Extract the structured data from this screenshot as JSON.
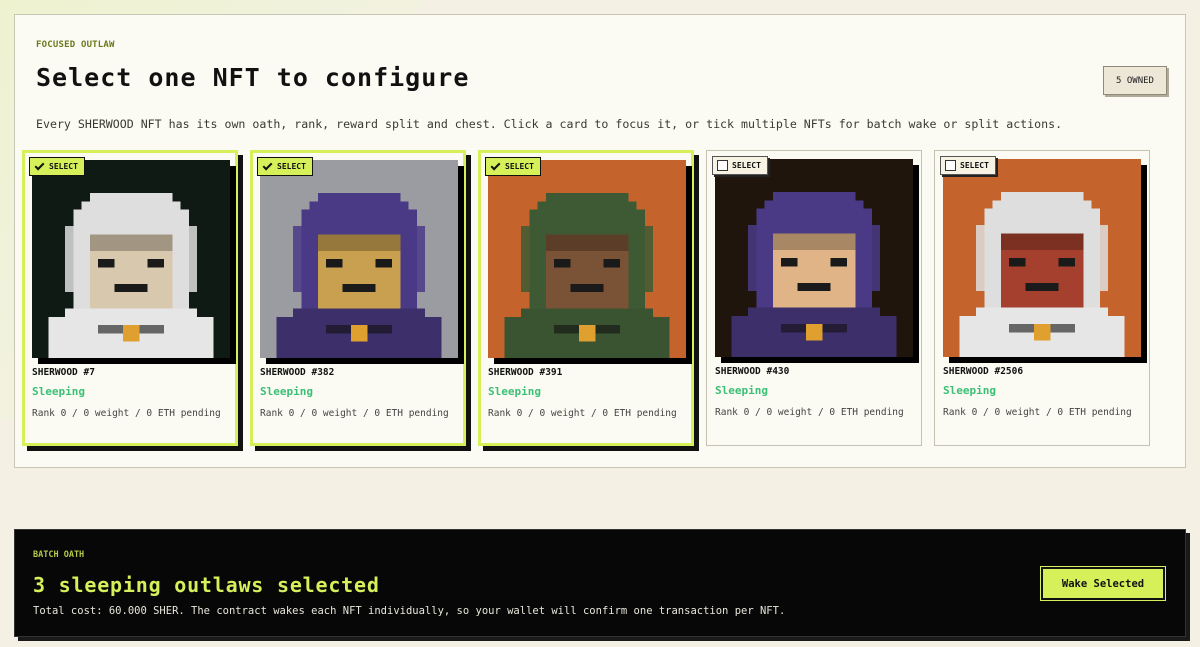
{
  "header": {
    "kicker": "FOCUSED OUTLAW",
    "title": "Select one NFT to configure",
    "owned_badge": "5 OWNED",
    "description": "Every SHERWOOD NFT has its own oath, rank, reward split and chest. Click a card to focus it, or tick multiple NFTs for batch wake or split actions."
  },
  "cards": [
    {
      "select_label": "SELECT",
      "selected": true,
      "name": "SHERWOOD #7",
      "status": "Sleeping",
      "stats": "Rank 0 / 0 weight / 0 ETH pending",
      "bg_color": "#0f1a14",
      "hood_color": "#dedede",
      "skin_color": "#d8c9ae",
      "body_color": "#e6e6e6"
    },
    {
      "select_label": "SELECT",
      "selected": true,
      "name": "SHERWOOD #382",
      "status": "Sleeping",
      "stats": "Rank 0 / 0 weight / 0 ETH pending",
      "bg_color": "#9a9ca2",
      "hood_color": "#4a3a86",
      "skin_color": "#c8a050",
      "body_color": "#3c2f6a"
    },
    {
      "select_label": "SELECT",
      "selected": true,
      "name": "SHERWOOD #391",
      "status": "Sleeping",
      "stats": "Rank 0 / 0 weight / 0 ETH pending",
      "bg_color": "#c4642c",
      "hood_color": "#3e5a34",
      "skin_color": "#7a5236",
      "body_color": "#3a5432"
    },
    {
      "select_label": "SELECT",
      "selected": false,
      "name": "SHERWOOD #430",
      "status": "Sleeping",
      "stats": "Rank 0 / 0 weight / 0 ETH pending",
      "bg_color": "#1f150c",
      "hood_color": "#4a3a86",
      "skin_color": "#e0b486",
      "body_color": "#3c2f6a"
    },
    {
      "select_label": "SELECT",
      "selected": false,
      "name": "SHERWOOD #2506",
      "status": "Sleeping",
      "stats": "Rank 0 / 0 weight / 0 ETH pending",
      "bg_color": "#c4642c",
      "hood_color": "#dedede",
      "skin_color": "#a6402e",
      "body_color": "#e6e6e6"
    }
  ],
  "batch": {
    "kicker": "BATCH OATH",
    "title": "3 sleeping outlaws selected",
    "cost_text": "Total cost: 60.000 SHER. The contract wakes each NFT individually, so your wallet will confirm one transaction per NFT.",
    "button_label": "Wake Selected"
  },
  "colors": {
    "accent": "#d6f05a",
    "status_green": "#3bbf76",
    "dark_panel": "#070707"
  }
}
